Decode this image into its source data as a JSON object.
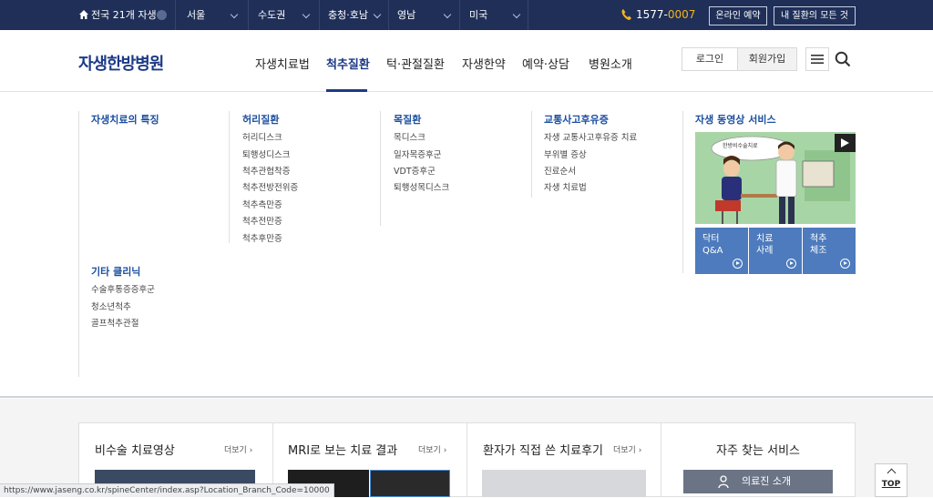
{
  "topbar": {
    "branch_label": "전국 21개 자생",
    "regions": [
      "서울",
      "수도권",
      "충청·호남",
      "영남",
      "미국"
    ],
    "phone": "1577-",
    "phone_suffix": "0007",
    "online_booking": "온라인 예약",
    "all_about": "내 질환의 모든 것"
  },
  "header": {
    "logo": "자생한방병원",
    "nav": [
      "자생치료법",
      "척추질환",
      "턱·관절질환",
      "자생한약",
      "예약·상담",
      "병원소개"
    ],
    "login": "로그인",
    "signup": "회원가입"
  },
  "mega": {
    "col1_title": "자생치료의 특징",
    "col2_title": "허리질환",
    "col2_items": [
      "허리디스크",
      "퇴행성디스크",
      "척추관협착증",
      "척추전방전위증",
      "척추측만증",
      "척추전만증",
      "척추후만증"
    ],
    "col3_title": "목질환",
    "col3_items": [
      "목디스크",
      "일자목증후군",
      "VDT증후군",
      "퇴행성목디스크"
    ],
    "col4_title": "교통사고후유증",
    "col4_items": [
      "자생 교통사고후유증 치료",
      "부위별 증상",
      "진료순서",
      "자생 치료법"
    ],
    "col5_title": "자생 동영상 서비스",
    "video_caption": "한방비수술치료",
    "tiles": [
      {
        "line1": "닥터",
        "line2": "Q&A"
      },
      {
        "line1": "치료",
        "line2": "사례"
      },
      {
        "line1": "척추",
        "line2": "체조"
      }
    ],
    "col6_title": "기타 클리닉",
    "col6_items": [
      "수술후통증증후군",
      "청소년척추",
      "골프척추관절"
    ]
  },
  "bottom": {
    "cards": [
      {
        "title": "비수술 치료영상",
        "more": "더보기"
      },
      {
        "title": "MRI로 보는 치료 결과",
        "more": "더보기"
      },
      {
        "title": "환자가 직접 쓴 치료후기",
        "more": "더보기"
      },
      {
        "title": "자주 찾는 서비스"
      }
    ],
    "doctor_button": "의료진 소개",
    "top_button": "TOP"
  },
  "status_url": "https://www.jaseng.co.kr/spineCenter/index.asp?Location_Branch_Code=10000"
}
